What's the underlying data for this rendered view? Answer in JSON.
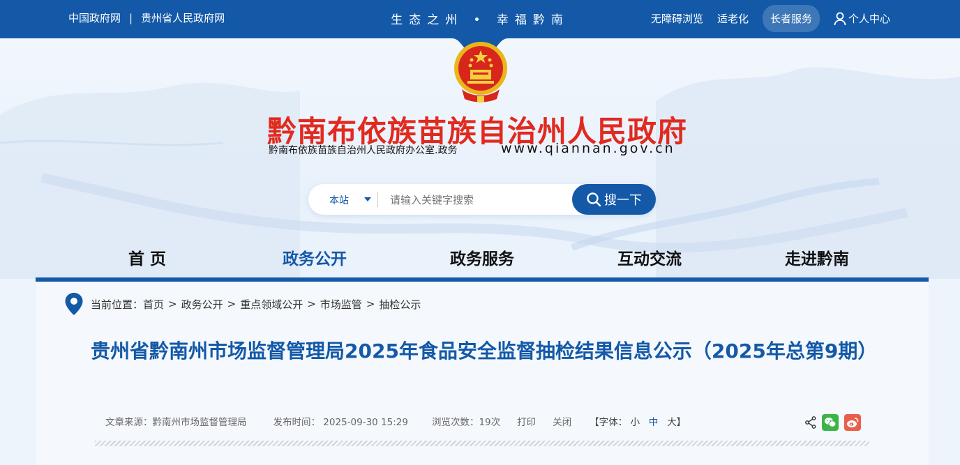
{
  "topbar": {
    "links": [
      "中国政府网",
      "贵州省人民政府网"
    ],
    "separator": "|",
    "slogan": "生态之州 • 幸福黔南",
    "right": {
      "accessible": "无障碍浏览",
      "elderly_adapt": "适老化",
      "elderly_service": "长者服务",
      "personal_center": "个人中心"
    }
  },
  "header": {
    "title": "黔南布依族苗族自治州人民政府",
    "subtitle": "黔南布依族苗族自治州人民政府办公室.政务",
    "url": "www.qiannan.gov.cn"
  },
  "search": {
    "scope": "本站",
    "placeholder": "请输入关键字搜索",
    "button": "搜一下"
  },
  "nav": {
    "items": [
      "首 页",
      "政务公开",
      "政务服务",
      "互动交流",
      "走进黔南"
    ],
    "active_index": 1
  },
  "breadcrumb": {
    "label": "当前位置：",
    "items": [
      "首页",
      "政务公开",
      "重点领域公开",
      "市场监管",
      "抽检公示"
    ],
    "separator": ">"
  },
  "article": {
    "title": "贵州省黔南州市场监督管理局2025年食品安全监督抽检结果信息公示（2025年总第9期）",
    "source": "文章来源：黔南州市场监督管理局",
    "publish_time": "发布时间： 2025-09-30 15:29",
    "views": "浏览次数：19次",
    "print": "打印",
    "close": "关闭",
    "font_prefix": "【字体：",
    "font_small": "小",
    "font_medium": "中",
    "font_large": "大】"
  },
  "colors": {
    "primary": "#1359a8",
    "title_red": "#e12a1f",
    "wechat": "#3bb44a",
    "weibo": "#e8604c"
  }
}
